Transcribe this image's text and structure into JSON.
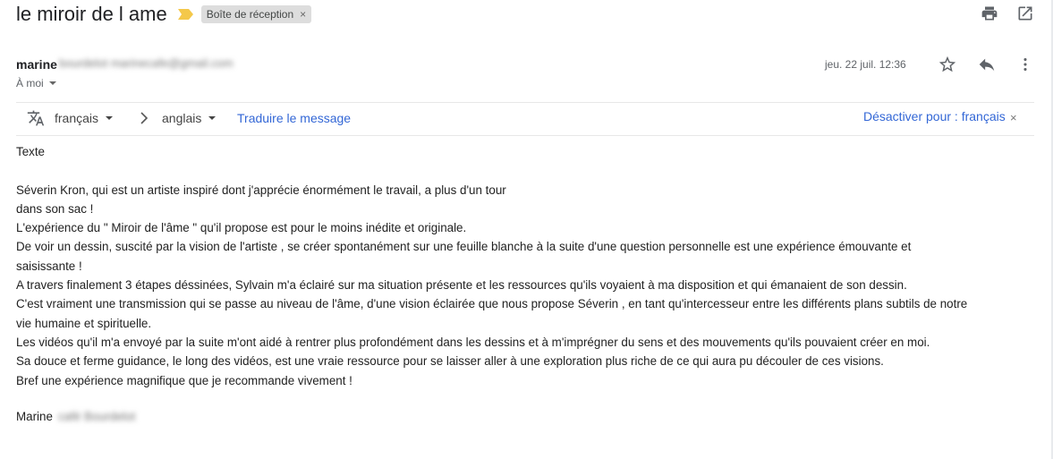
{
  "subject": "le miroir de l ame",
  "label_chip": "Boîte de réception",
  "label_chip_close": "×",
  "sender": {
    "name": "marine",
    "redacted_detail": "bourdelot  marinecafe@gmail.com"
  },
  "recipient": "À moi",
  "date": "jeu. 22 juil. 12:36",
  "translate": {
    "source_lang": "français",
    "target_lang": "anglais",
    "translate_link": "Traduire le message",
    "deactivate": "Désactiver pour : français",
    "close": "×"
  },
  "body": {
    "lines": [
      "Texte",
      "",
      "Séverin Kron, qui est un artiste inspiré dont j'apprécie énormément le travail, a plus d'un tour",
      "dans son sac !",
      "L'expérience du \" Miroir de l'âme \" qu'il propose est pour le moins inédite et originale.",
      "De voir un dessin, suscité par la vision de l'artiste , se créer spontanément  sur une feuille blanche à la suite d'une question personnelle est une expérience émouvante et",
      "saisissante !",
      "A travers finalement 3 étapes déssinées, Sylvain m'a éclairé sur ma situation présente et les ressources qu'ils voyaient à ma disposition et qui émanaient de son dessin.",
      "C'est vraiment une transmission qui se passe au niveau de l'âme, d'une vision éclairée que nous propose Séverin , en tant qu'intercesseur entre les différents plans subtils de notre",
      "vie humaine et spirituelle.",
      "Les vidéos qu'il m'a envoyé par la suite m'ont aidé à rentrer plus profondément dans les dessins et à m'imprégner du sens et des mouvements qu'ils pouvaient créer en moi.",
      "Sa douce et ferme guidance, le long des vidéos, est une vraie ressource pour se laisser aller à une exploration plus riche de ce qui aura pu découler de ces visions.",
      "Bref une expérience magnifique que je recommande  vivement !"
    ],
    "signoff": "Marine",
    "signoff_redacted": "café Bourdelot"
  },
  "icons": {
    "importance": "importance-marker-icon",
    "print": "print-icon",
    "open_new_window": "open-in-new-window-icon",
    "star": "star-icon",
    "reply": "reply-icon",
    "more": "more-vertical-icon",
    "translate": "translate-icon",
    "chevron": "chevron-right-icon"
  },
  "colors": {
    "importance_marker": "#f4c84a",
    "link": "#3367d6",
    "label_chip_bg": "#dddddd"
  }
}
